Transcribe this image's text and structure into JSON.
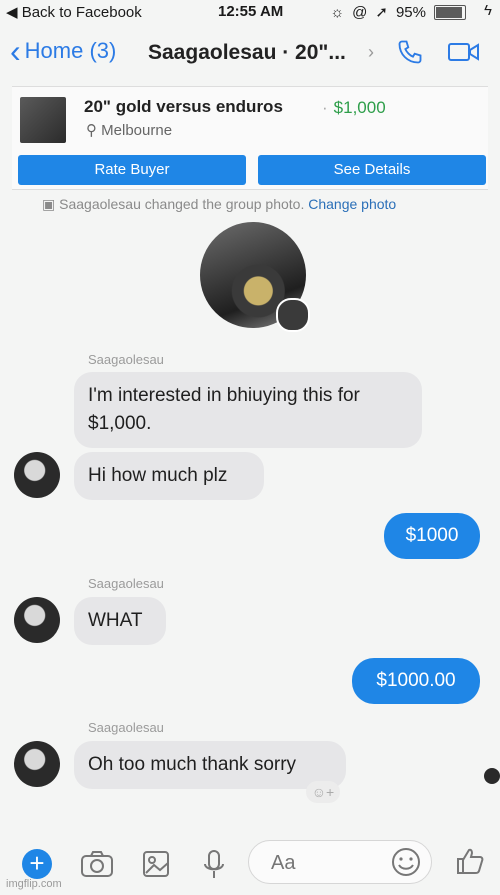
{
  "status_bar": {
    "back": "◀ Back to Facebook",
    "time": "12:55 AM",
    "battery": "95%",
    "battery_level": 0.95
  },
  "nav": {
    "home": "Home (3)",
    "title": "Saagaolesau · 20\"..."
  },
  "listing": {
    "title": "20\" gold versus enduros",
    "price": "$1,000",
    "location": "Melbourne",
    "rate_button": "Rate Buyer",
    "details_button": "See Details"
  },
  "system_message": {
    "text": "Saagaolesau changed the group photo.",
    "link": "Change photo"
  },
  "messages": [
    {
      "sender": "Saagaolesau",
      "text": "I'm interested in bhiuying this for\n$1,000.",
      "direction": "in"
    },
    {
      "text": "Hi how much plz",
      "direction": "in"
    },
    {
      "text": "$1000",
      "direction": "out"
    },
    {
      "sender": "Saagaolesau",
      "text": "WHAT",
      "direction": "in"
    },
    {
      "text": "$1000.00",
      "direction": "out"
    },
    {
      "sender": "Saagaolesau",
      "text": "Oh too much thank sorry",
      "direction": "in"
    }
  ],
  "composer": {
    "placeholder": "Aa"
  },
  "reaction_hint": "☺+",
  "watermark": "imgflip.com",
  "colors": {
    "accent": "#1f86e6",
    "price": "#2e9e4a",
    "bubble_in": "#e6e6e8"
  }
}
